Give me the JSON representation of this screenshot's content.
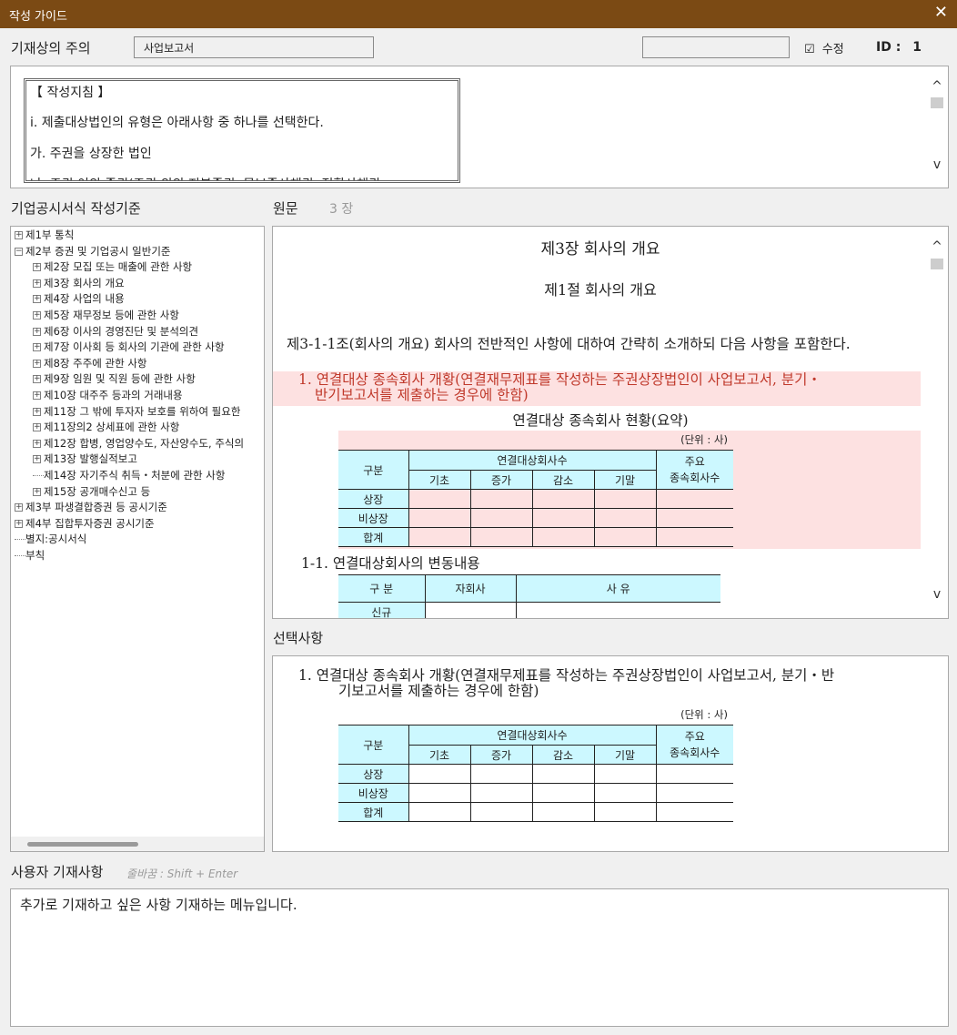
{
  "window": {
    "title": "작성 가이드",
    "close_glyph": "✕"
  },
  "header": {
    "label": "기재상의 주의",
    "report_type": "사업보고서",
    "search_value": "",
    "edit_checkbox": {
      "checked": true,
      "label": "수정",
      "glyph": "☑"
    },
    "id_label": "ID :",
    "id_value": "1"
  },
  "guide": {
    "lines": [
      "【 작성지침 】",
      "i. 제출대상법인의 유형은 아래사항 중 하나를 선택한다.",
      "가. 주권을 상장한 법인",
      "나. 주권 이외 증권(주권 외의 지분증권, 무보증사채권, 전환사채권"
    ]
  },
  "scroll": {
    "up": "^",
    "down": "v"
  },
  "tree": {
    "title": "기업공시서식 작성기준",
    "items": [
      {
        "label": "제1부 통칙",
        "toggle": "+",
        "level": 0
      },
      {
        "label": "제2부 증권 및 기업공시 일반기준",
        "toggle": "−",
        "level": 0
      },
      {
        "label": "제2장 모집 또는 매출에 관한 사항",
        "toggle": "+",
        "level": 1
      },
      {
        "label": "제3장 회사의 개요",
        "toggle": "+",
        "level": 1
      },
      {
        "label": "제4장 사업의 내용",
        "toggle": "+",
        "level": 1
      },
      {
        "label": "제5장 재무정보 등에 관한 사항",
        "toggle": "+",
        "level": 1
      },
      {
        "label": "제6장 이사의 경영진단 및 분석의견",
        "toggle": "+",
        "level": 1
      },
      {
        "label": "제7장 이사회 등 회사의 기관에 관한 사항",
        "toggle": "+",
        "level": 1
      },
      {
        "label": "제8장 주주에 관한 사항",
        "toggle": "+",
        "level": 1
      },
      {
        "label": "제9장 임원 및 직원 등에 관한 사항",
        "toggle": "+",
        "level": 1
      },
      {
        "label": "제10장 대주주 등과의 거래내용",
        "toggle": "+",
        "level": 1
      },
      {
        "label": "제11장 그 밖에 투자자 보호를 위하여 필요한",
        "toggle": "+",
        "level": 1
      },
      {
        "label": "제11장의2 상세표에 관한 사항",
        "toggle": "+",
        "level": 1
      },
      {
        "label": "제12장 합병, 영업양수도, 자산양수도, 주식의",
        "toggle": "+",
        "level": 1
      },
      {
        "label": "제13장 발행실적보고",
        "toggle": "+",
        "level": 1
      },
      {
        "label": "제14장 자기주식 취득・처분에 관한 사항",
        "toggle": "",
        "level": 1
      },
      {
        "label": "제15장 공개매수신고 등",
        "toggle": "+",
        "level": 1
      },
      {
        "label": "제3부 파생결합증권 등 공시기준",
        "toggle": "+",
        "level": 0
      },
      {
        "label": "제4부 집합투자증권 공시기준",
        "toggle": "+",
        "level": 0
      },
      {
        "label": "별지:공시서식",
        "toggle": "",
        "level": 0
      },
      {
        "label": "부칙",
        "toggle": "",
        "level": 0
      }
    ]
  },
  "original": {
    "title": "원문",
    "chapter_badge": "3 장",
    "heading": "제3장 회사의 개요",
    "subheading": "제1절 회사의 개요",
    "article": "제3-1-1조(회사의 개요) 회사의 전반적인 사항에 대하여 간략히 소개하되 다음 사항을 포함한다.",
    "item1_line1": "1. 연결대상 종속회사 개황(연결재무제표를 작성하는 주권상장법인이 사업보고서, 분기・",
    "item1_line2": "반기보고서를 제출하는 경우에 한함)",
    "table_caption": "연결대상 종속회사 현황(요약)",
    "unit": "(단위 : 사)",
    "item11": "1-1. 연결대상회사의 변동내용",
    "table2_headers": [
      "구 분",
      "자회사",
      "사 유"
    ],
    "table2_first_cell": "신규"
  },
  "subsidiary_table": {
    "col_group": "구분",
    "group_header": "연결대상회사수",
    "main_header": "주요\n종속회사수",
    "sub_headers": [
      "기초",
      "증가",
      "감소",
      "기말"
    ],
    "rows": [
      "상장",
      "비상장",
      "합계"
    ]
  },
  "selection": {
    "title": "선택사항",
    "item1_line1": "1. 연결대상 종속회사 개황(연결재무제표를 작성하는 주권상장법인이 사업보고서, 분기・반",
    "item1_line2": "기보고서를 제출하는 경우에 한함)",
    "unit": "(단위 : 사)"
  },
  "user_entry": {
    "label": "사용자 기재사항",
    "hint": "줄바꿈 : Shift + Enter",
    "text": "추가로 기재하고 싶은 사항 기재하는 메뉴입니다."
  },
  "colors": {
    "titlebar": "#7b4a14",
    "highlight": "#fde1e1",
    "table_header": "#ccf8ff",
    "highlight_text": "#c0392b"
  }
}
